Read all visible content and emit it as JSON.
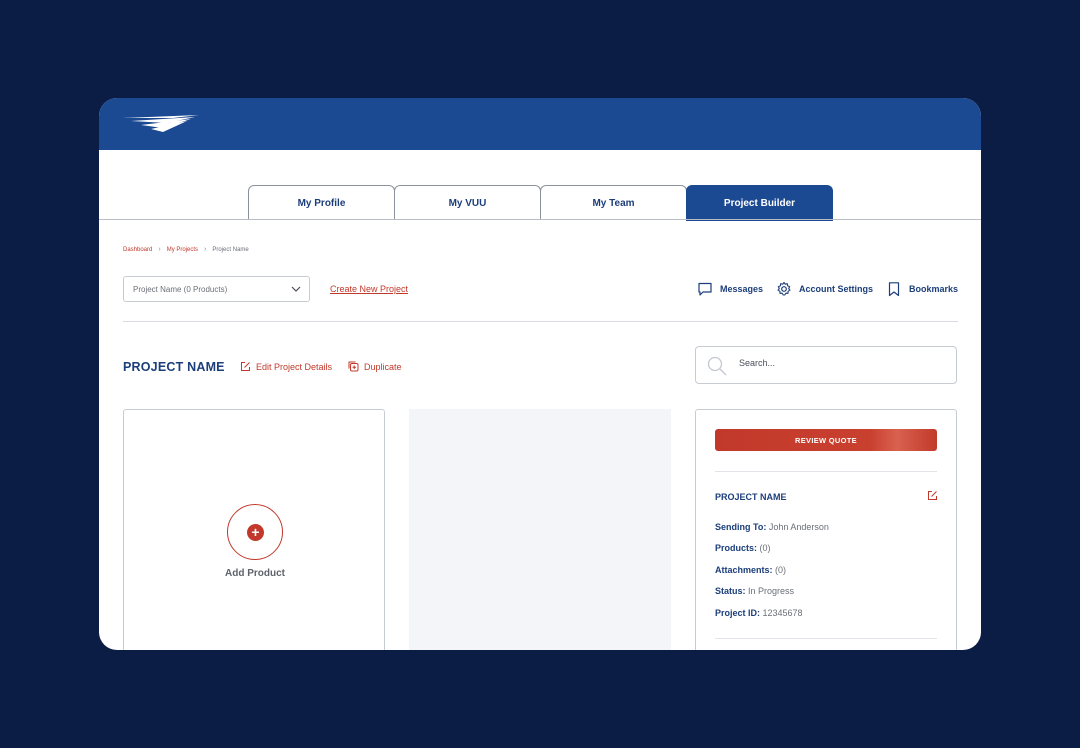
{
  "tabs": [
    {
      "label": "My Profile",
      "active": false
    },
    {
      "label": "My VUU",
      "active": false
    },
    {
      "label": "My Team",
      "active": false
    },
    {
      "label": "Project Builder",
      "active": true
    }
  ],
  "breadcrumb": {
    "items": [
      "Dashboard",
      "My Projects",
      "Project Name"
    ]
  },
  "project_select": {
    "value": "Project Name (0 Products)"
  },
  "create_link": "Create New Project",
  "utilities": {
    "messages": "Messages",
    "account_settings": "Account Settings",
    "bookmarks": "Bookmarks"
  },
  "project": {
    "title": "PROJECT NAME",
    "edit_label": "Edit Project Details",
    "duplicate_label": "Duplicate"
  },
  "search": {
    "placeholder": "Search..."
  },
  "add_product": {
    "label": "Add Product"
  },
  "summary": {
    "review_button": "REVIEW QUOTE",
    "title": "PROJECT NAME",
    "rows": [
      {
        "label": "Sending To:",
        "value": "John Anderson"
      },
      {
        "label": "Products:",
        "value": "(0)"
      },
      {
        "label": "Attachments:",
        "value": "(0)"
      },
      {
        "label": "Status:",
        "value": "In Progress"
      },
      {
        "label": "Project ID:",
        "value": "12345678"
      }
    ]
  },
  "colors": {
    "background": "#0b1d44",
    "brand_blue": "#1c4a92",
    "accent_red": "#c2392b",
    "navy_text": "#1c3e7a"
  },
  "icons": [
    "logo",
    "chevron-down-icon",
    "message-icon",
    "gear-icon",
    "bookmark-icon",
    "edit-icon",
    "duplicate-icon",
    "search-icon",
    "plus-icon"
  ]
}
